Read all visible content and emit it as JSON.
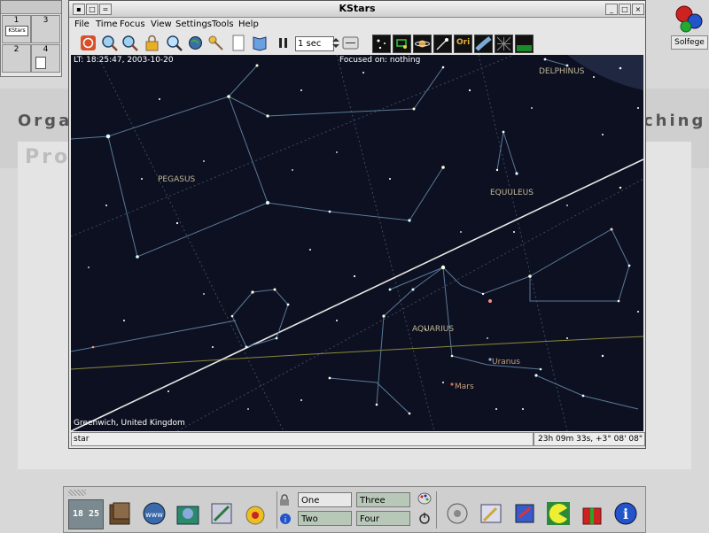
{
  "desktop": {
    "bg_word_left": "Orga",
    "bg_word_right": "ching",
    "bg_word_faded": "Pro"
  },
  "pager": {
    "desktops": [
      {
        "number": "1",
        "thumb_label": "KStars"
      },
      {
        "number": "3",
        "thumb_label": ""
      },
      {
        "number": "2",
        "thumb_label": ""
      },
      {
        "number": "4",
        "thumb_label": ""
      }
    ]
  },
  "solfege": {
    "label": "Solfege"
  },
  "window": {
    "title": "KStars",
    "menu": [
      "File",
      "Time",
      "Focus",
      "View",
      "Settings",
      "Tools",
      "Help"
    ],
    "toolbar": {
      "time_step": "1 sec",
      "icons": [
        "stop-clock-icon",
        "zoom-in-icon",
        "zoom-out-icon",
        "lock-icon",
        "find-object-icon",
        "globe-icon",
        "key-icon",
        "page-icon",
        "book-icon",
        "pause-icon",
        "time-step-spinner",
        "stars-toggle-icon",
        "deep-sky-toggle-icon",
        "planets-toggle-icon",
        "comets-toggle-icon",
        "constellations-lines-icon",
        "milky-way-icon",
        "coordinate-grid-icon",
        "horizon-icon"
      ],
      "ori_label": "Ori"
    },
    "sky": {
      "info_time": "LT: 18:25:47,  2003-10-20",
      "info_focus": "Focused on: nothing",
      "info_location": "Greenwich, United Kingdom",
      "constellations": [
        "PEGASUS",
        "EQUULEUS",
        "DELPHINUS",
        "AQUARIUS"
      ],
      "planets": [
        "Uranus",
        "Mars"
      ]
    },
    "statusbar": {
      "object": "star",
      "coordinates": "23h 09m 33s,  +3° 08' 08\""
    }
  },
  "panel": {
    "clock_text": "18 25",
    "desktops": [
      "One",
      "Three",
      "Two",
      "Four"
    ],
    "app_icons_left": [
      "terminal-icon",
      "www-browser-icon",
      "home-folder-icon",
      "window-list-icon",
      "helper-icon"
    ],
    "app_icons_right": [
      "sound-icon",
      "editor-icon",
      "game-icon",
      "pacman-icon",
      "gift-icon",
      "info-icon"
    ]
  }
}
